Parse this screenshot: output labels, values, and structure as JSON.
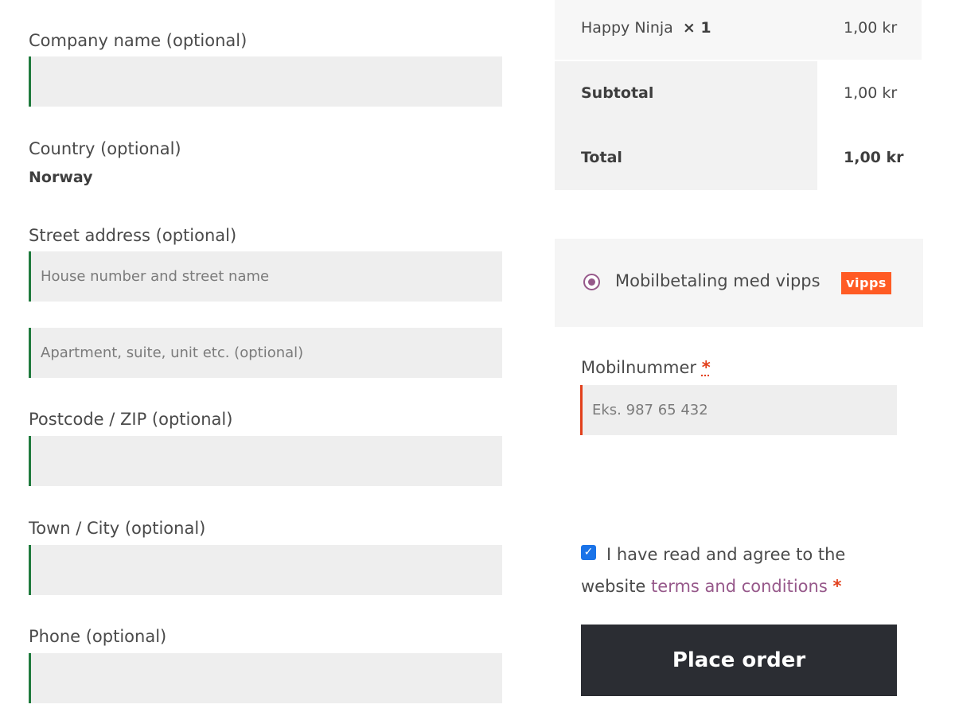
{
  "billing": {
    "company": {
      "label": "Company name (optional)",
      "value": "",
      "placeholder": ""
    },
    "country": {
      "label": "Country (optional)",
      "value": "Norway"
    },
    "street": {
      "label": "Street address (optional)",
      "line1_placeholder": "House number and street name",
      "line2_placeholder": "Apartment, suite, unit etc. (optional)"
    },
    "postcode": {
      "label": "Postcode / ZIP (optional)",
      "value": ""
    },
    "city": {
      "label": "Town / City (optional)",
      "value": ""
    },
    "phone": {
      "label": "Phone (optional)",
      "value": ""
    }
  },
  "order": {
    "item": {
      "name": "Happy Ninja",
      "qty": "× 1",
      "price": "1,00 kr"
    },
    "subtotal": {
      "label": "Subtotal",
      "value": "1,00 kr"
    },
    "total": {
      "label": "Total",
      "value": "1,00 kr"
    }
  },
  "payment": {
    "method_label": "Mobilbetaling med vipps",
    "logo_text": "vipps",
    "selected": true
  },
  "mobile": {
    "label": "Mobilnummer",
    "required_mark": "*",
    "placeholder": "Eks. 987 65 432"
  },
  "terms": {
    "checked": true,
    "text": "I have read and agree to the website",
    "link_text": "terms and conditions",
    "required_mark": "*"
  },
  "place_order_label": "Place order",
  "colors": {
    "accent": "#96588a",
    "valid_border": "#1f7a3d",
    "invalid_border": "#e2401c",
    "button_bg": "#2b2d33",
    "vipps_orange": "#ff5b24"
  }
}
